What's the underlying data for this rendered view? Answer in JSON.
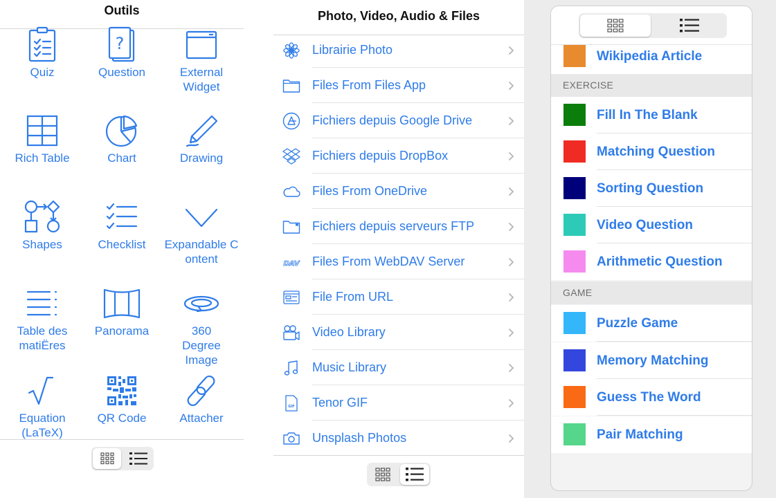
{
  "panel1": {
    "title": "Outils",
    "tools": [
      {
        "label": "Quiz",
        "icon": "quiz-icon"
      },
      {
        "label": "Question",
        "icon": "question-icon"
      },
      {
        "label": "External Widget",
        "icon": "external-widget-icon"
      },
      {
        "label": "Rich Table",
        "icon": "table-icon"
      },
      {
        "label": "Chart",
        "icon": "pie-chart-icon"
      },
      {
        "label": "Drawing",
        "icon": "pencil-icon"
      },
      {
        "label": "Shapes",
        "icon": "shapes-icon"
      },
      {
        "label": "Checklist",
        "icon": "checklist-icon"
      },
      {
        "label": "Expandable Content",
        "icon": "chevron-down-icon"
      },
      {
        "label": "Table des matiËres",
        "icon": "toc-icon"
      },
      {
        "label": "Panorama",
        "icon": "panorama-icon"
      },
      {
        "label": "360 Degree Image",
        "icon": "rotate-360-icon"
      },
      {
        "label": "Equation (LaTeX)",
        "icon": "sqrt-icon"
      },
      {
        "label": "QR Code",
        "icon": "qr-code-icon"
      },
      {
        "label": "Attacher",
        "icon": "link-icon"
      }
    ],
    "view_toggle": {
      "selected": "grid"
    }
  },
  "panel2": {
    "title": "Photo, Video, Audio & Files",
    "items": [
      {
        "label": "Librairie Photo",
        "icon": "photos-icon"
      },
      {
        "label": "Files From Files App",
        "icon": "folder-icon"
      },
      {
        "label": "Fichiers depuis Google Drive",
        "icon": "google-drive-icon"
      },
      {
        "label": "Fichiers depuis DropBox",
        "icon": "dropbox-icon"
      },
      {
        "label": "Files From OneDrive",
        "icon": "cloud-icon"
      },
      {
        "label": "Fichiers depuis serveurs FTP",
        "icon": "ftp-folder-icon"
      },
      {
        "label": "Files From WebDAV Server",
        "icon": "webdav-icon"
      },
      {
        "label": "File From URL",
        "icon": "url-icon"
      },
      {
        "label": "Video Library",
        "icon": "video-camera-icon"
      },
      {
        "label": "Music Library",
        "icon": "music-note-icon"
      },
      {
        "label": "Tenor GIF",
        "icon": "gif-file-icon"
      },
      {
        "label": "Unsplash Photos",
        "icon": "camera-icon"
      }
    ],
    "view_toggle": {
      "selected": "list"
    }
  },
  "panel3": {
    "view_toggle": {
      "selected": "grid"
    },
    "top_item": {
      "label": "Wikipedia Article",
      "color": "#E88A2E"
    },
    "sections": [
      {
        "title": "EXERCISE",
        "items": [
          {
            "label": "Fill In The Blank",
            "color": "#0B7D0B"
          },
          {
            "label": "Matching Question",
            "color": "#F02B23"
          },
          {
            "label": "Sorting Question",
            "color": "#00007A"
          },
          {
            "label": "Video Question",
            "color": "#2ECAB8"
          },
          {
            "label": "Arithmetic Question",
            "color": "#F58BEF"
          }
        ]
      },
      {
        "title": "GAME",
        "items": [
          {
            "label": "Puzzle Game",
            "color": "#34B6FA"
          },
          {
            "label": "Memory Matching",
            "color": "#3347DE"
          },
          {
            "label": "Guess The Word",
            "color": "#FA6A14"
          },
          {
            "label": "Pair Matching",
            "color": "#55D68A"
          }
        ]
      }
    ]
  },
  "colors": {
    "accent": "#2F7CE8",
    "separator": "#E3E3E3",
    "section_bg": "#E8E8E8"
  }
}
